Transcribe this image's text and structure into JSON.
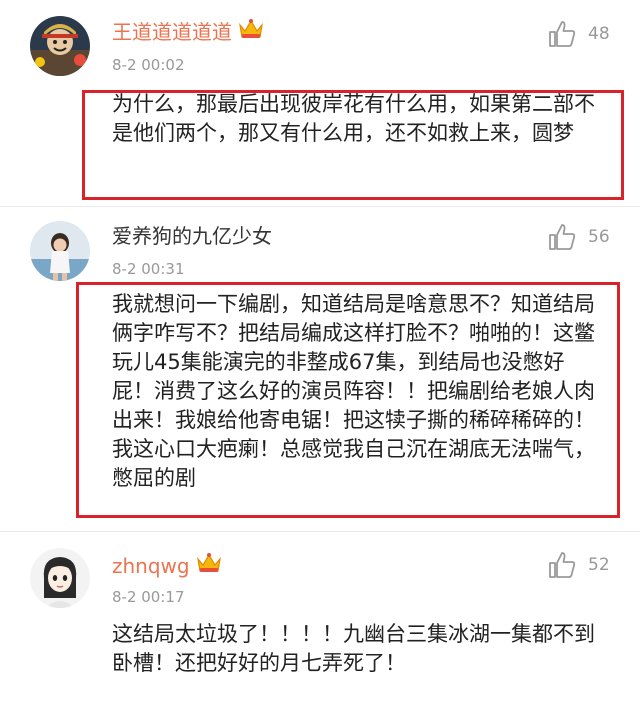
{
  "comments": [
    {
      "username": "王道道道道道",
      "vip": true,
      "crown_icon": "crown-icon",
      "timestamp": "8-2 00:02",
      "likes": "48",
      "text": "为什么，那最后出现彼岸花有什么用，如果第二部不是他们两个，那又有什么用，还不如救上来，圆梦",
      "highlighted": true
    },
    {
      "username": "爱养狗的九亿少女",
      "vip": false,
      "timestamp": "8-2 00:31",
      "likes": "56",
      "text": "我就想问一下编剧，知道结局是啥意思不？知道结局俩字咋写不？把结局编成这样打脸不？啪啪的！这鳖玩儿45集能演完的非整成67集，到结局也没憋好屁！消费了这么好的演员阵容！！把编剧给老娘人肉出来！我娘给他寄电锯！把这犊子撕的稀碎稀碎的！我这心口大疤瘌！总感觉我自己沉在湖底无法喘气，憋屈的剧",
      "highlighted": true
    },
    {
      "username": "zhnqwg",
      "vip": true,
      "crown_icon": "crown-icon",
      "timestamp": "8-2 00:17",
      "likes": "52",
      "text": "这结局太垃圾了！！！！九幽台三集冰湖一集都不到卧槽！还把好好的月七弄死了！",
      "highlighted": false
    }
  ],
  "colors": {
    "vip_name": "#eb7350",
    "highlight_border": "#d8232a",
    "meta_text": "#999999"
  }
}
